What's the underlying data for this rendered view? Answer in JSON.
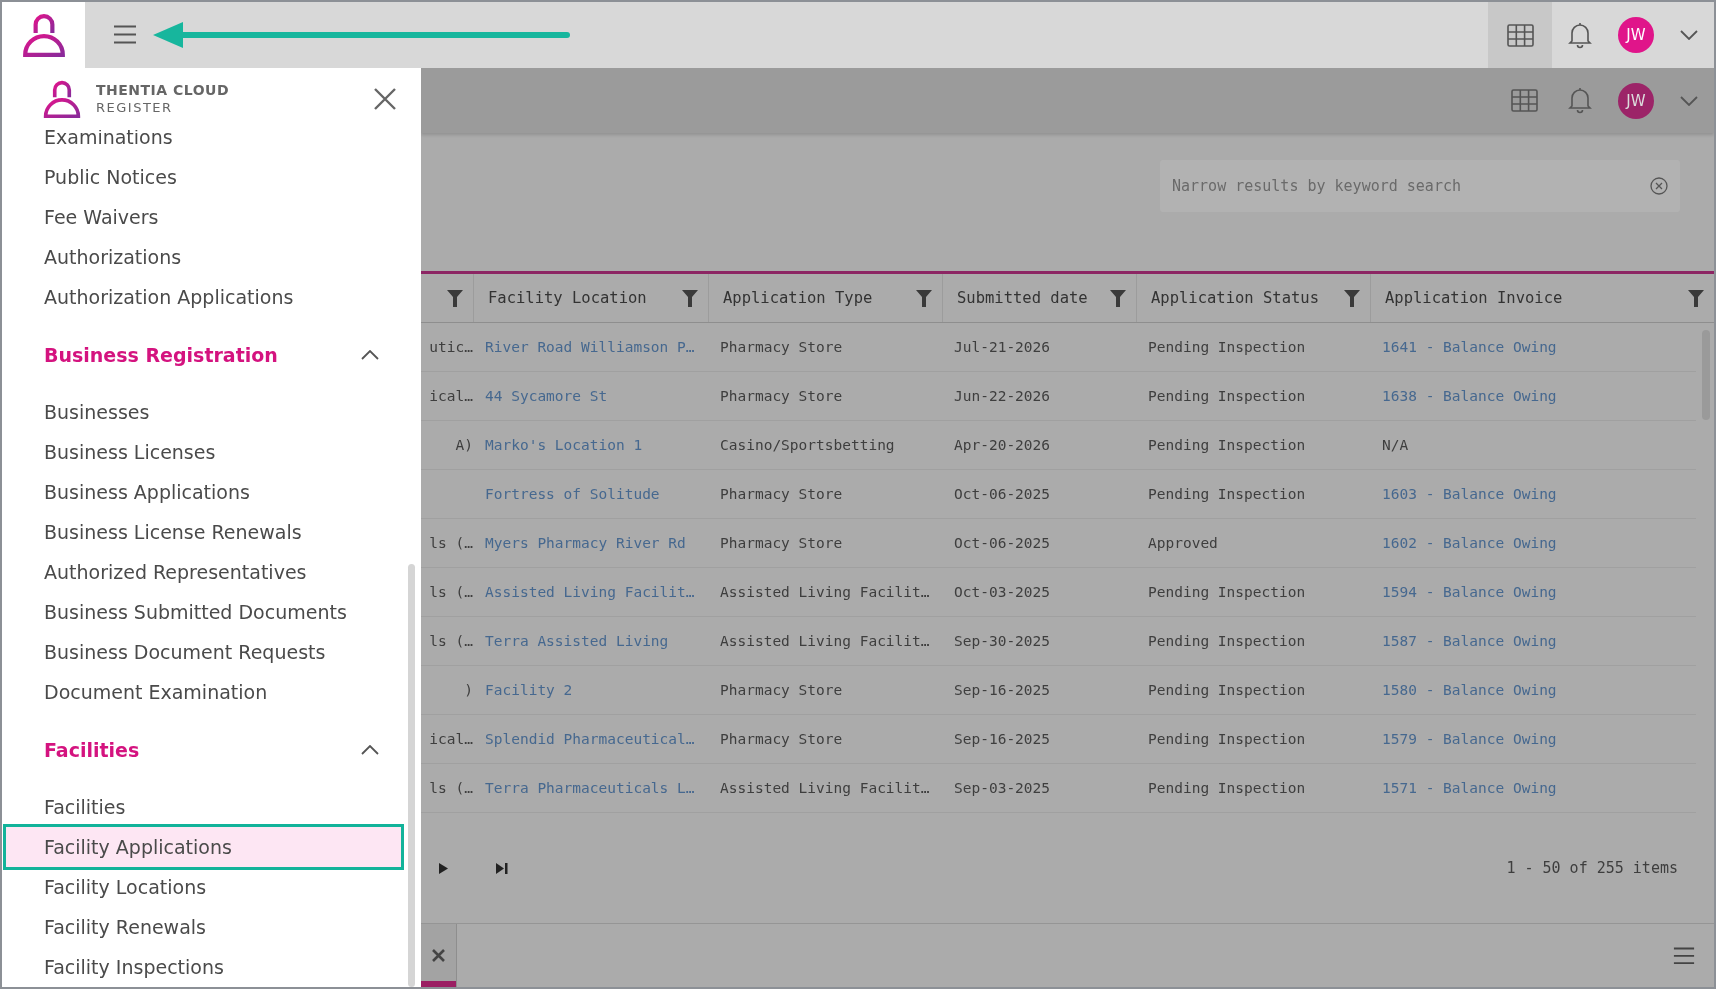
{
  "top_bar": {
    "avatar": "JW"
  },
  "sidebar": {
    "brand": {
      "name": "THENTIA CLOUD",
      "product": "REGISTER"
    },
    "sections": [
      {
        "items": [
          {
            "label": "Examinations",
            "selected": false
          },
          {
            "label": "Public Notices",
            "selected": false
          },
          {
            "label": "Fee Waivers",
            "selected": false
          },
          {
            "label": "Authorizations",
            "selected": false
          },
          {
            "label": "Authorization Applications",
            "selected": false
          }
        ]
      },
      {
        "title": "Business Registration",
        "expanded": true,
        "items": [
          {
            "label": "Businesses",
            "selected": false
          },
          {
            "label": "Business Licenses",
            "selected": false
          },
          {
            "label": "Business Applications",
            "selected": false
          },
          {
            "label": "Business License Renewals",
            "selected": false
          },
          {
            "label": "Authorized Representatives",
            "selected": false
          },
          {
            "label": "Business Submitted Documents",
            "selected": false
          },
          {
            "label": "Business Document Requests",
            "selected": false
          },
          {
            "label": "Document Examination",
            "selected": false
          }
        ]
      },
      {
        "title": "Facilities",
        "expanded": true,
        "items": [
          {
            "label": "Facilities",
            "selected": false
          },
          {
            "label": "Facility Applications",
            "selected": true
          },
          {
            "label": "Facility Locations",
            "selected": false
          },
          {
            "label": "Facility Renewals",
            "selected": false
          },
          {
            "label": "Facility Inspections",
            "selected": false
          }
        ]
      }
    ]
  },
  "header": {
    "avatar": "JW"
  },
  "search": {
    "placeholder": "Narrow results by keyword search"
  },
  "table": {
    "columns": [
      "Facility Location",
      "Application Type",
      "Submitted date",
      "Application Status",
      "Application Invoice"
    ],
    "rows": [
      {
        "column_1": "utic…",
        "location": "River Road Williamson P…",
        "type": "Pharmacy Store",
        "date": "Jul-21-2026",
        "status": "Pending Inspection",
        "invoice": {
          "text": "1641 - Balance Owing",
          "link": true
        }
      },
      {
        "column_1": "ical…",
        "location": "44 Sycamore St",
        "type": "Pharmacy Store",
        "date": "Jun-22-2026",
        "status": "Pending Inspection",
        "invoice": {
          "text": "1638 - Balance Owing",
          "link": true
        }
      },
      {
        "column_1": "A)",
        "location": "Marko's Location 1",
        "type": "Casino/Sportsbetting",
        "date": "Apr-20-2026",
        "status": "Pending Inspection",
        "invoice": {
          "text": "N/A",
          "link": false
        }
      },
      {
        "location": "Fortress of Solitude",
        "type": "Pharmacy Store",
        "date": "Oct-06-2025",
        "status": "Pending Inspection",
        "invoice": {
          "text": "1603 - Balance Owing",
          "link": true
        }
      },
      {
        "column_1": "ls (…",
        "location": "Myers Pharmacy River Rd",
        "type": "Pharmacy Store",
        "date": "Oct-06-2025",
        "status": "Approved",
        "invoice": {
          "text": "1602 - Balance Owing",
          "link": true
        }
      },
      {
        "column_1": "ls (…",
        "location": "Assisted Living Facilit…",
        "type": "Assisted Living Facilit…",
        "date": "Oct-03-2025",
        "status": "Pending Inspection",
        "invoice": {
          "text": "1594 - Balance Owing",
          "link": true
        }
      },
      {
        "column_1": "ls (…",
        "location": "Terra Assisted Living",
        "type": "Assisted Living Facilit…",
        "date": "Sep-30-2025",
        "status": "Pending Inspection",
        "invoice": {
          "text": "1587 - Balance Owing",
          "link": true
        }
      },
      {
        "column_1": ")",
        "location": "Facility 2",
        "type": "Pharmacy Store",
        "date": "Sep-16-2025",
        "status": "Pending Inspection",
        "invoice": {
          "text": "1580 - Balance Owing",
          "link": true
        }
      },
      {
        "column_1": "ical…",
        "location": "Splendid Pharmaceutical…",
        "type": "Pharmacy Store",
        "date": "Sep-16-2025",
        "status": "Pending Inspection",
        "invoice": {
          "text": "1579 - Balance Owing",
          "link": true
        }
      },
      {
        "column_1": "ls (…",
        "location": "Terra Pharmaceuticals L…",
        "type": "Assisted Living Facilit…",
        "date": "Sep-03-2025",
        "status": "Pending Inspection",
        "invoice": {
          "text": "1571 - Balance Owing",
          "link": true
        }
      }
    ]
  },
  "pager": {
    "summary": "1 - 50 of 255 items"
  }
}
